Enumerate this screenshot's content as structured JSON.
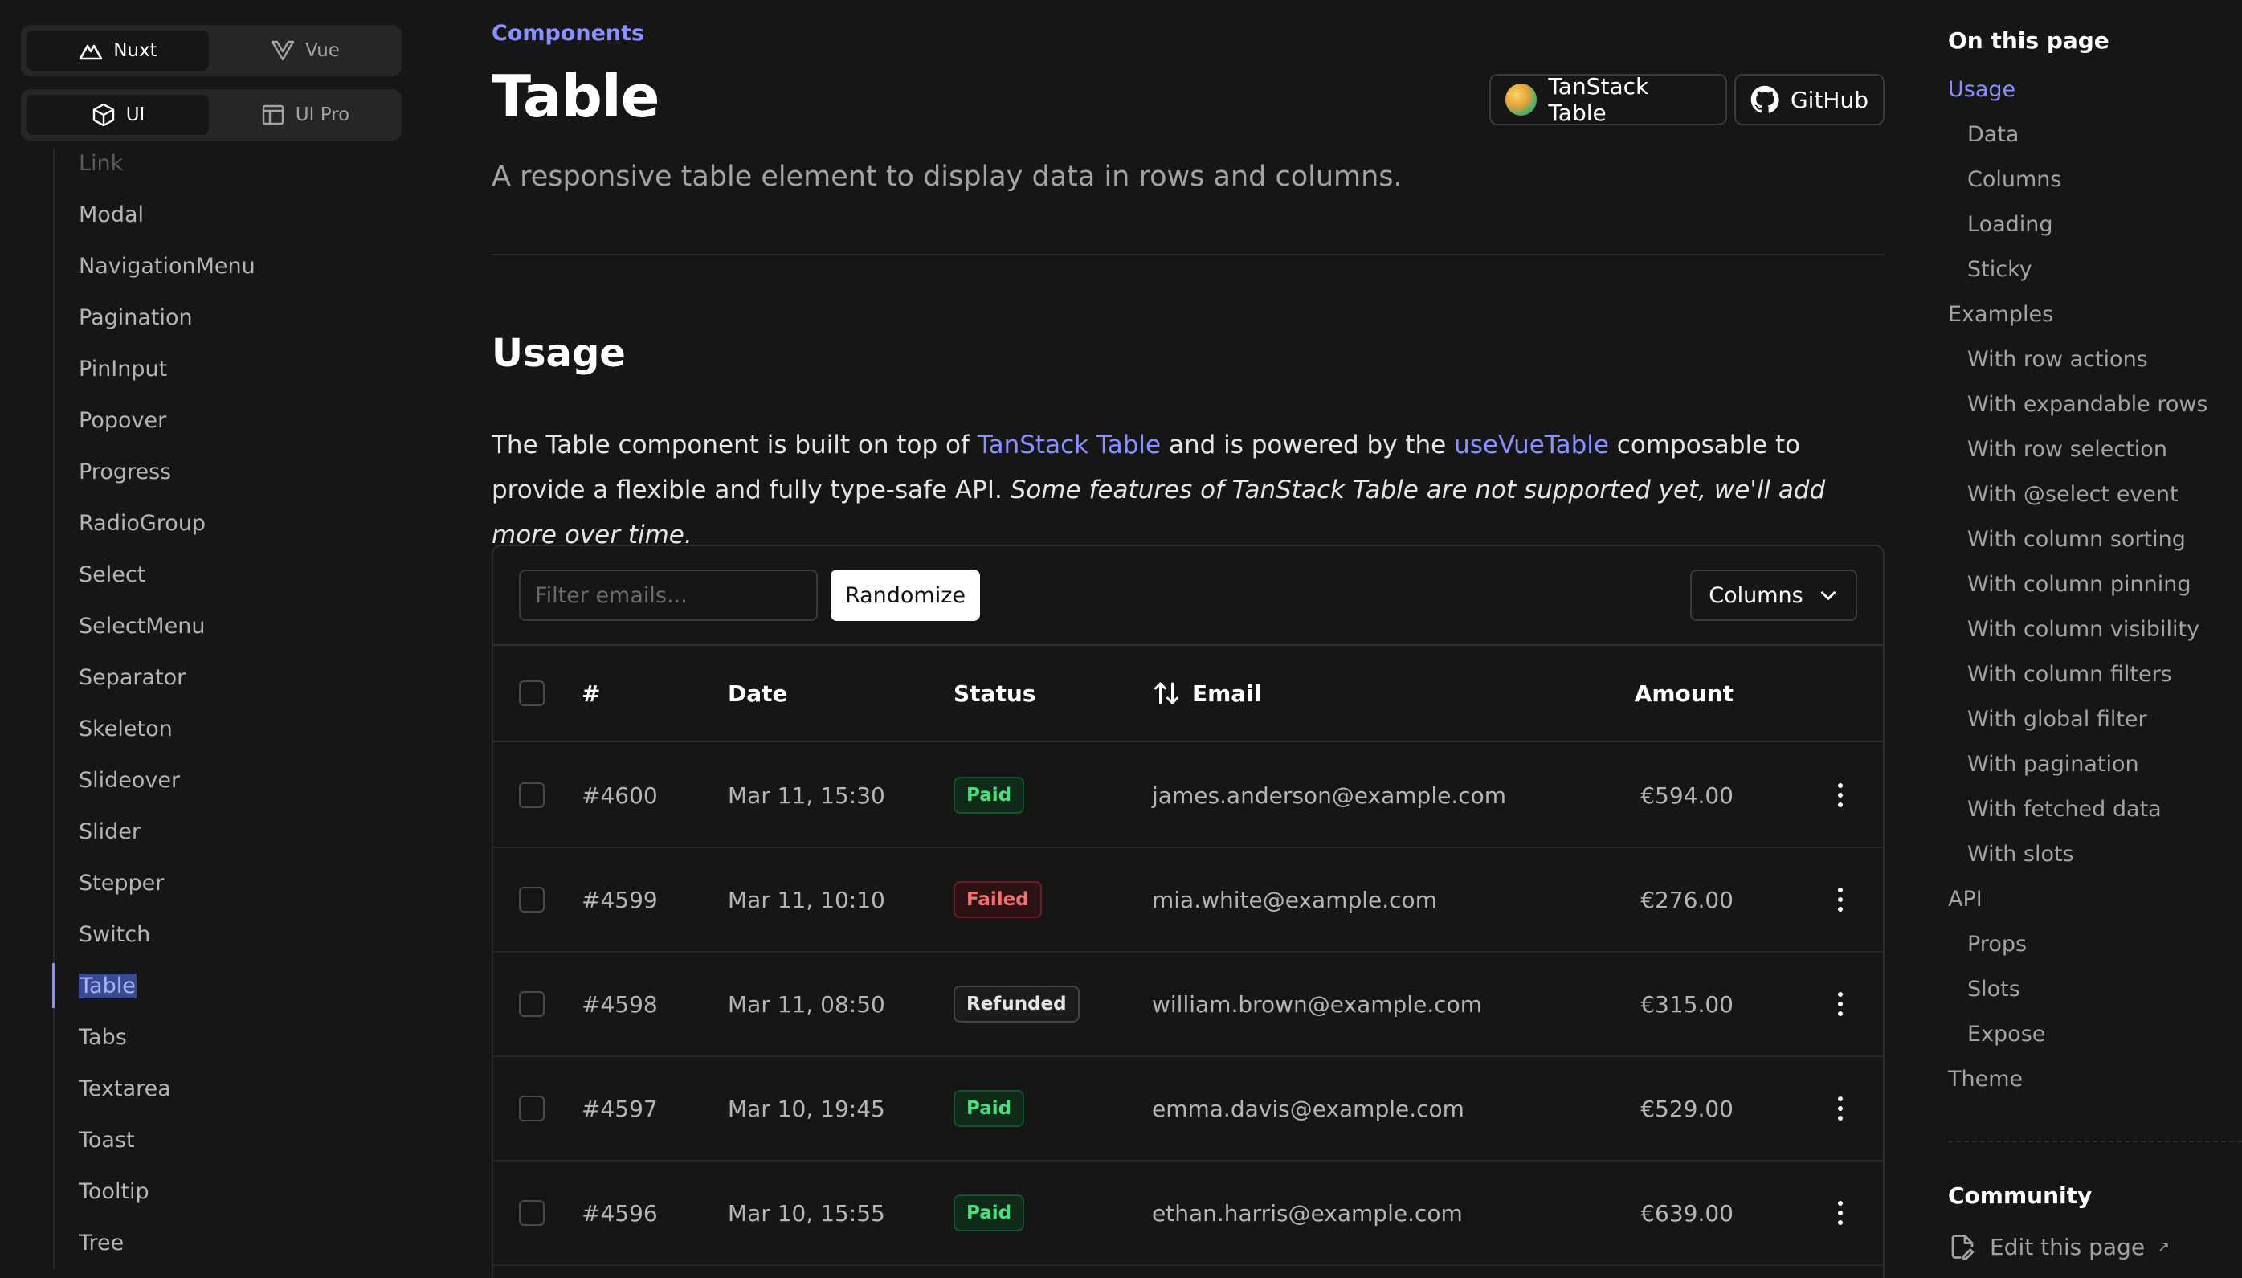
{
  "framework_switch": {
    "options": [
      {
        "label": "Nuxt",
        "icon": "nuxt-icon",
        "active": true
      },
      {
        "label": "Vue",
        "icon": "vue-icon",
        "active": false
      }
    ]
  },
  "product_switch": {
    "options": [
      {
        "label": "UI",
        "icon": "cube-icon",
        "active": true
      },
      {
        "label": "UI Pro",
        "icon": "layout-icon",
        "active": false
      }
    ]
  },
  "sidebar": {
    "items": [
      "Link",
      "Modal",
      "NavigationMenu",
      "Pagination",
      "PinInput",
      "Popover",
      "Progress",
      "RadioGroup",
      "Select",
      "SelectMenu",
      "Separator",
      "Skeleton",
      "Slideover",
      "Slider",
      "Stepper",
      "Switch",
      "Table",
      "Tabs",
      "Textarea",
      "Toast",
      "Tooltip",
      "Tree"
    ],
    "active": "Table"
  },
  "header": {
    "breadcrumb": "Components",
    "title": "Table",
    "description": "A responsive table element to display data in rows and columns.",
    "links": {
      "tanstack": "TanStack Table",
      "github": "GitHub"
    }
  },
  "usage": {
    "heading": "Usage",
    "p_before": "The Table component is built on top of ",
    "link1": "TanStack Table",
    "p_mid": " and is powered by the ",
    "link2": "useVueTable",
    "p_after": " composable to provide a flexible and fully type-safe API. ",
    "p_italic": "Some features of TanStack Table are not supported yet, we'll add more over time."
  },
  "table_example": {
    "filter_placeholder": "Filter emails...",
    "randomize_label": "Randomize",
    "columns_label": "Columns",
    "headers": {
      "id": "#",
      "date": "Date",
      "status": "Status",
      "email": "Email",
      "amount": "Amount"
    },
    "rows": [
      {
        "id": "#4600",
        "date": "Mar 11, 15:30",
        "status": "Paid",
        "email": "james.anderson@example.com",
        "amount": "€594.00"
      },
      {
        "id": "#4599",
        "date": "Mar 11, 10:10",
        "status": "Failed",
        "email": "mia.white@example.com",
        "amount": "€276.00"
      },
      {
        "id": "#4598",
        "date": "Mar 11, 08:50",
        "status": "Refunded",
        "email": "william.brown@example.com",
        "amount": "€315.00"
      },
      {
        "id": "#4597",
        "date": "Mar 10, 19:45",
        "status": "Paid",
        "email": "emma.davis@example.com",
        "amount": "€529.00"
      },
      {
        "id": "#4596",
        "date": "Mar 10, 15:55",
        "status": "Paid",
        "email": "ethan.harris@example.com",
        "amount": "€639.00"
      }
    ]
  },
  "toc": {
    "title": "On this page",
    "items": [
      {
        "label": "Usage",
        "level": 1,
        "active": true
      },
      {
        "label": "Data",
        "level": 2
      },
      {
        "label": "Columns",
        "level": 2
      },
      {
        "label": "Loading",
        "level": 2
      },
      {
        "label": "Sticky",
        "level": 2
      },
      {
        "label": "Examples",
        "level": 1
      },
      {
        "label": "With row actions",
        "level": 2
      },
      {
        "label": "With expandable rows",
        "level": 2
      },
      {
        "label": "With row selection",
        "level": 2
      },
      {
        "label": "With @select event",
        "level": 2
      },
      {
        "label": "With column sorting",
        "level": 2
      },
      {
        "label": "With column pinning",
        "level": 2
      },
      {
        "label": "With column visibility",
        "level": 2
      },
      {
        "label": "With column filters",
        "level": 2
      },
      {
        "label": "With global filter",
        "level": 2
      },
      {
        "label": "With pagination",
        "level": 2
      },
      {
        "label": "With fetched data",
        "level": 2
      },
      {
        "label": "With slots",
        "level": 2
      },
      {
        "label": "API",
        "level": 1
      },
      {
        "label": "Props",
        "level": 2
      },
      {
        "label": "Slots",
        "level": 2
      },
      {
        "label": "Expose",
        "level": 2
      },
      {
        "label": "Theme",
        "level": 1
      }
    ],
    "community_title": "Community",
    "edit_label": "Edit this page",
    "edit_suffix": "↗"
  },
  "colors": {
    "accent": "#8b8fff",
    "background": "#161616",
    "paid": "#4ade80",
    "failed": "#f87171"
  }
}
